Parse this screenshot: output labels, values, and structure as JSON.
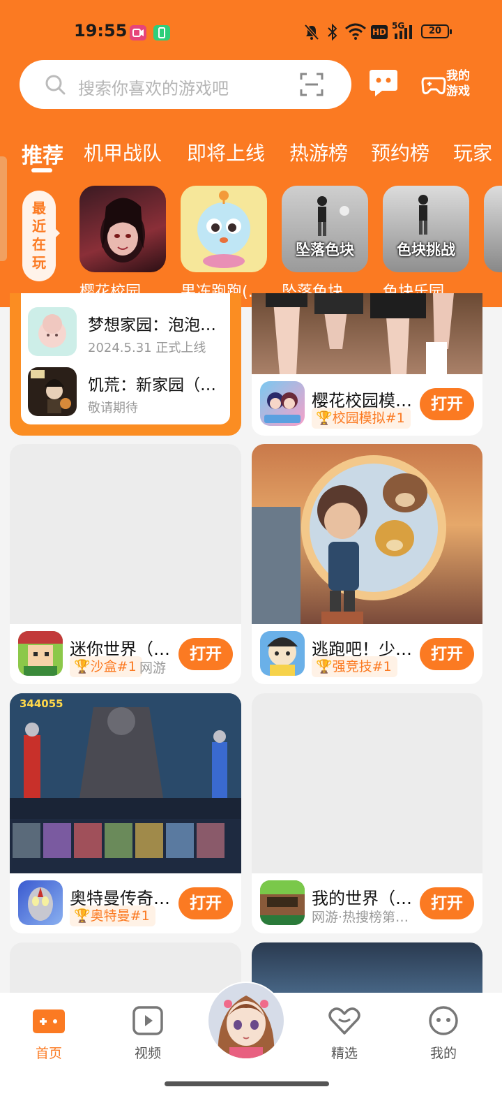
{
  "status_bar": {
    "time": "19:55",
    "battery": "20",
    "network": "5G",
    "hd": "HD"
  },
  "search": {
    "placeholder": "搜索你喜欢的游戏吧"
  },
  "header_actions": {
    "my_games": "我的游戏"
  },
  "tabs": [
    "推荐",
    "机甲战队",
    "即将上线",
    "热游榜",
    "预约榜",
    "玩家"
  ],
  "recent": {
    "label": "最近在玩",
    "games": [
      {
        "name": "樱花校园…"
      },
      {
        "name": "果冻跑跑(…"
      },
      {
        "name": "坠落色块…",
        "overlay": "坠落色块"
      },
      {
        "name": "色块乐园…",
        "overlay": "色块挑战"
      }
    ]
  },
  "upcoming": [
    {
      "title": "梦想家园：泡泡…",
      "status": "2024.5.31 正式上线"
    },
    {
      "title": "饥荒：新家园（…",
      "status": "敬请期待"
    }
  ],
  "feed": [
    {
      "title": "樱花校园模…",
      "tag": "校园模拟#1",
      "button": "打开"
    },
    {
      "title": "迷你世界（…",
      "tag": "沙盒#1",
      "sub": "网游",
      "button": "打开"
    },
    {
      "title": "逃跑吧！少…",
      "tag": "强竞技#1",
      "button": "打开"
    },
    {
      "title": "奥特曼传奇…",
      "tag": "奥特曼#1",
      "button": "打开",
      "score": "344055"
    },
    {
      "title": "我的世界（…",
      "sub": "网游·热搜榜第…",
      "button": "打开"
    }
  ],
  "bottom_nav": [
    {
      "label": "首页",
      "active": true
    },
    {
      "label": "视频"
    },
    {
      "label": ""
    },
    {
      "label": "精选"
    },
    {
      "label": "我的"
    }
  ],
  "colors": {
    "accent": "#fb7a22",
    "background": "#f4f4f4"
  }
}
